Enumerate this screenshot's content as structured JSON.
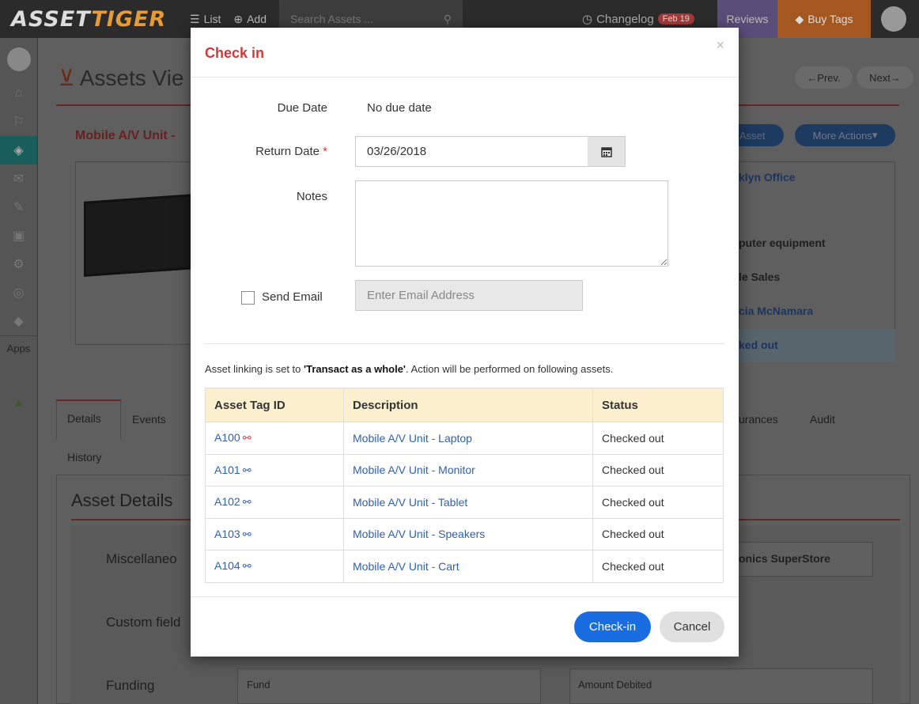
{
  "topbar": {
    "logo_a": "ASSET",
    "logo_b": "TIGER",
    "list_label": "List",
    "add_label": "Add",
    "search_placeholder": "Search Assets ...",
    "changelog_label": "Changelog",
    "changelog_badge": "Feb 19",
    "reviews_label": "Reviews",
    "buytags_label": "Buy Tags"
  },
  "sidebar": {
    "apps_label": "Apps"
  },
  "background": {
    "page_title": "Assets Vie",
    "prev_label": "Prev.",
    "next_label": "Next",
    "asset_name": "Mobile A/V Unit -",
    "edit_asset_label": "t Asset",
    "more_actions_label": "More Actions",
    "site_value": "klyn Office",
    "category_value": "puter equipment",
    "department_value": "le Sales",
    "assigned_value": "cia McNamara",
    "status_value": "ked out",
    "tabs": [
      "Details",
      "Events",
      "urances",
      "Audit",
      "History"
    ],
    "asset_details_title": "Asset Details",
    "misc_label": "Miscellaneo",
    "vendor_value": "onics SuperStore",
    "custom_label": "Custom field",
    "funding_label": "Funding",
    "fund_label": "Fund",
    "amount_debited_label": "Amount Debited"
  },
  "modal": {
    "title": "Check in",
    "close": "×",
    "due_date_label": "Due Date",
    "due_date_value": "No due date",
    "return_date_label": "Return Date",
    "required_mark": "*",
    "return_date_value": "03/26/2018",
    "notes_label": "Notes",
    "notes_value": "",
    "send_email_label": "Send Email",
    "email_placeholder": "Enter Email Address",
    "linking_note_pre": "Asset linking is set to ",
    "linking_note_mode": "'Transact as a whole'",
    "linking_note_post": ". Action will be performed on following assets.",
    "table": {
      "headers": [
        "Asset Tag ID",
        "Description",
        "Status"
      ],
      "rows": [
        {
          "tag": "A100",
          "description": "Mobile A/V Unit - Laptop",
          "status": "Checked out",
          "link_color": "#d0393a"
        },
        {
          "tag": "A101",
          "description": "Mobile A/V Unit - Monitor",
          "status": "Checked out",
          "link_color": "#3060b0"
        },
        {
          "tag": "A102",
          "description": "Mobile A/V Unit - Tablet",
          "status": "Checked out",
          "link_color": "#3060b0"
        },
        {
          "tag": "A103",
          "description": "Mobile A/V Unit - Speakers",
          "status": "Checked out",
          "link_color": "#3060b0"
        },
        {
          "tag": "A104",
          "description": "Mobile A/V Unit - Cart",
          "status": "Checked out",
          "link_color": "#3060b0"
        }
      ]
    },
    "checkin_label": "Check-in",
    "cancel_label": "Cancel"
  },
  "colors": {
    "accent_red": "#d0393a",
    "primary_blue": "#1a6de0",
    "header_yellow": "#fcf0cf"
  }
}
